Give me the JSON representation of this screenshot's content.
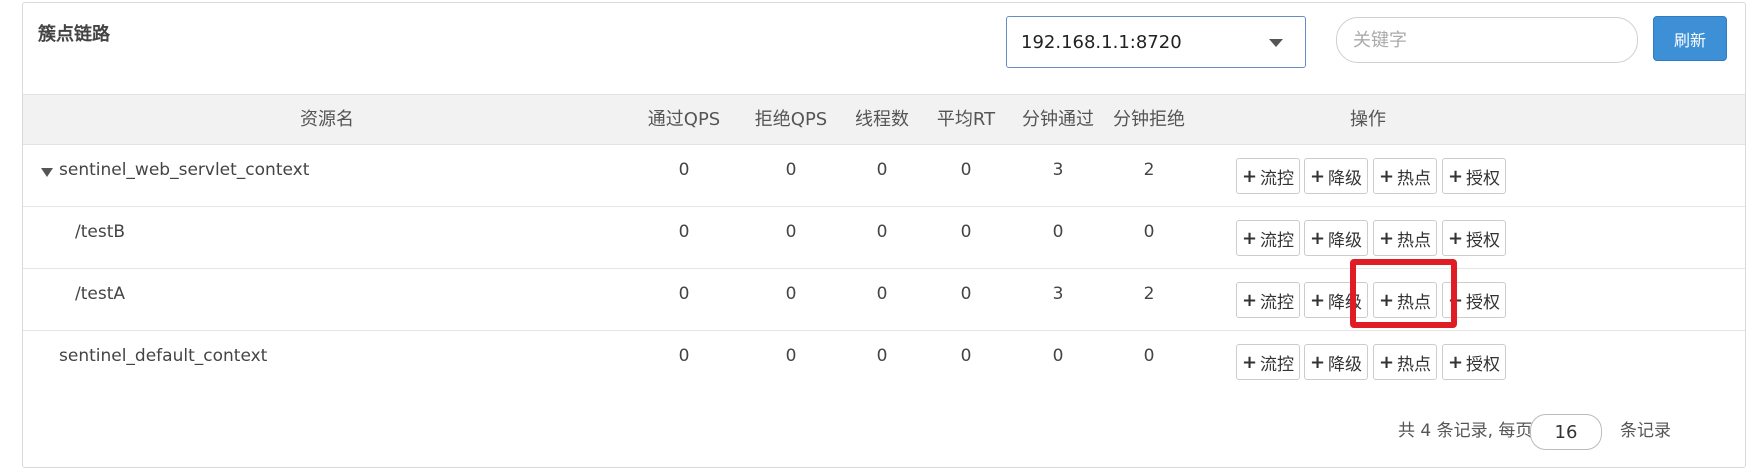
{
  "header": {
    "title": "簇点链路",
    "machine_select": "192.168.1.1:8720",
    "search_placeholder": "关键字",
    "refresh_label": "刷新"
  },
  "table": {
    "columns": [
      "资源名",
      "通过QPS",
      "拒绝QPS",
      "线程数",
      "平均RT",
      "分钟通过",
      "分钟拒绝",
      "操作"
    ],
    "rows": [
      {
        "name": "sentinel_web_servlet_context",
        "pass_qps": "0",
        "block_qps": "0",
        "threads": "0",
        "avg_rt": "0",
        "minute_pass": "3",
        "minute_block": "2"
      },
      {
        "name": "/testB",
        "pass_qps": "0",
        "block_qps": "0",
        "threads": "0",
        "avg_rt": "0",
        "minute_pass": "0",
        "minute_block": "0"
      },
      {
        "name": "/testA",
        "pass_qps": "0",
        "block_qps": "0",
        "threads": "0",
        "avg_rt": "0",
        "minute_pass": "3",
        "minute_block": "2"
      },
      {
        "name": "sentinel_default_context",
        "pass_qps": "0",
        "block_qps": "0",
        "threads": "0",
        "avg_rt": "0",
        "minute_pass": "0",
        "minute_block": "0"
      }
    ],
    "actions": {
      "flow": "流控",
      "degrade": "降级",
      "hotspot": "热点",
      "authority": "授权"
    },
    "plus_icon": "+"
  },
  "footer": {
    "prefix": "共 4 条记录, 每页",
    "page_size": "16",
    "suffix": "条记录"
  },
  "colors": {
    "highlight": "#e01d24",
    "primary": "#3d8fd6"
  }
}
